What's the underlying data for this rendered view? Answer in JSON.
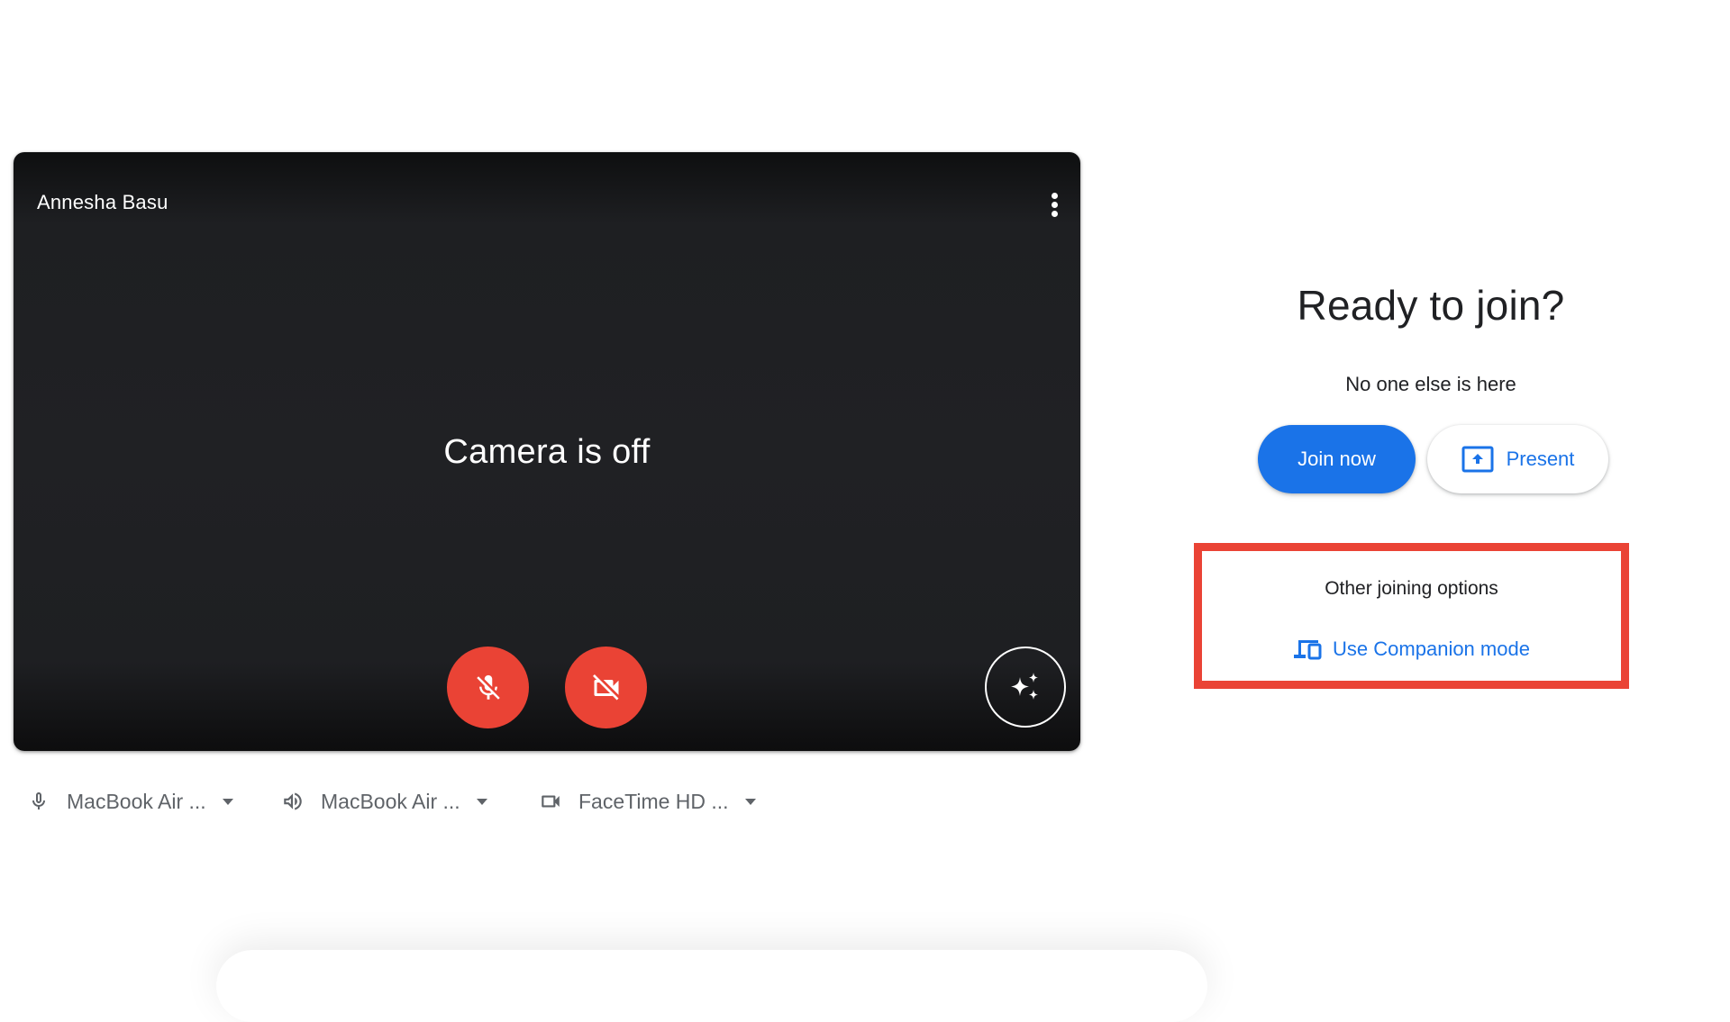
{
  "preview": {
    "participant_name": "Annesha Basu",
    "camera_status": "Camera is off",
    "more_options_icon": "more-vert-icon",
    "controls": {
      "mic": {
        "icon": "mic-off-icon",
        "state": "off"
      },
      "camera": {
        "icon": "videocam-off-icon",
        "state": "off"
      },
      "effects": {
        "icon": "sparkle-icon"
      }
    }
  },
  "devices": {
    "microphone": {
      "icon": "mic-icon",
      "label": "MacBook Air ..."
    },
    "speaker": {
      "icon": "speaker-icon",
      "label": "MacBook Air ..."
    },
    "camera": {
      "icon": "videocam-icon",
      "label": "FaceTime HD ..."
    }
  },
  "join_panel": {
    "heading": "Ready to join?",
    "status": "No one else is here",
    "join_now_label": "Join now",
    "present_label": "Present",
    "present_icon": "present-to-all-icon"
  },
  "other_options": {
    "title": "Other joining options",
    "companion_mode_label": "Use Companion mode",
    "companion_icon": "devices-icon",
    "highlight_color": "#ea4335"
  },
  "colors": {
    "brand_blue": "#1a73e8",
    "danger_red": "#ea4335",
    "video_bg": "#202124",
    "text_primary": "#202124",
    "text_secondary": "#5f6368"
  }
}
